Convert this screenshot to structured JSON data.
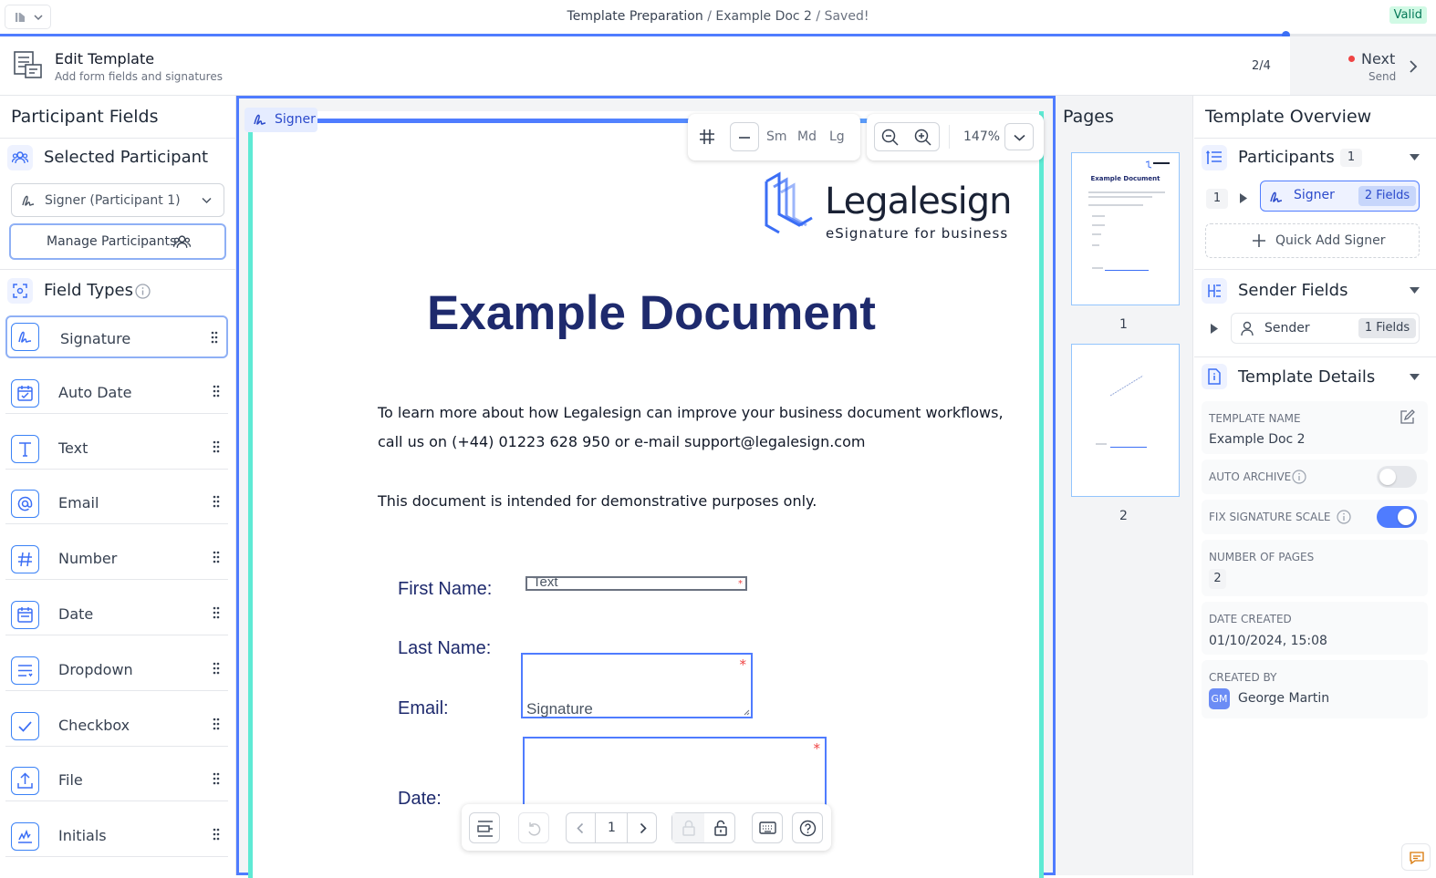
{
  "topbar": {
    "breadcrumb_1": "Template Preparation",
    "sep_1": " / ",
    "breadcrumb_2": "Example Doc 2",
    "sep_2": " / ",
    "status": "Saved!",
    "valid_badge": "Valid",
    "progress_fraction": 0.895
  },
  "header": {
    "title": "Edit Template",
    "subtitle": "Add form fields and signatures",
    "step": "2/4",
    "next_label": "Next",
    "next_sub": "Send"
  },
  "left": {
    "title": "Participant Fields",
    "selected_participant_heading": "Selected Participant",
    "participant_select_value": "Signer (Participant 1)",
    "manage_participants": "Manage Participants",
    "field_types_heading": "Field Types",
    "field_types": [
      {
        "label": "Signature",
        "icon": "signature-icon"
      },
      {
        "label": "Auto Date",
        "icon": "auto-date-icon"
      },
      {
        "label": "Text",
        "icon": "text-icon"
      },
      {
        "label": "Email",
        "icon": "at-icon"
      },
      {
        "label": "Number",
        "icon": "hash-icon"
      },
      {
        "label": "Date",
        "icon": "calendar-icon"
      },
      {
        "label": "Dropdown",
        "icon": "list-icon"
      },
      {
        "label": "Checkbox",
        "icon": "check-icon"
      },
      {
        "label": "File",
        "icon": "upload-icon"
      },
      {
        "label": "Initials",
        "icon": "initials-icon"
      }
    ]
  },
  "doc_toolbar": {
    "size_sm": "Sm",
    "size_md": "Md",
    "size_lg": "Lg",
    "zoom": "147%"
  },
  "document": {
    "signer_chip": "Signer",
    "brand_name": "Legalesign",
    "brand_tagline": "eSignature for business",
    "title": "Example Document",
    "para_1_line_1": "To learn more about how Legalesign can improve your business document workflows,",
    "para_1_line_2": "call us on (+44) 01223 628 950 or e-mail support@legalesign.com",
    "para_2": "This document is intended for demonstrative purposes only.",
    "labels": {
      "first_name": "First Name:",
      "last_name": "Last Name:",
      "email": "Email:",
      "date": "Date:"
    },
    "fields": {
      "text_field_label": "Text",
      "signature_field_label": "Signature",
      "required_mark": "*"
    }
  },
  "bottom_toolbar": {
    "page_input": "1"
  },
  "pages": {
    "title": "Pages",
    "items": [
      {
        "number": "1",
        "thumb_title": "Example Document"
      },
      {
        "number": "2"
      }
    ]
  },
  "right": {
    "title": "Template Overview",
    "participants_heading": "Participants",
    "participants_count": "1",
    "participant_index": "1",
    "participant_role": "Signer",
    "participant_fields": "2 Fields",
    "quick_add": "Quick Add Signer",
    "sender_heading": "Sender Fields",
    "sender_role": "Sender",
    "sender_fields": "1 Fields",
    "details_heading": "Template Details",
    "template_name_label": "TEMPLATE NAME",
    "template_name_value": "Example Doc 2",
    "auto_archive_label": "AUTO ARCHIVE",
    "auto_archive_on": false,
    "fix_sig_label": "FIX SIGNATURE SCALE",
    "fix_sig_on": true,
    "pages_label": "NUMBER OF PAGES",
    "pages_value": "2",
    "created_label": "DATE CREATED",
    "created_value": "01/10/2024, 15:08",
    "created_by_label": "CREATED BY",
    "created_by_initials": "GM",
    "created_by_name": "George Martin"
  },
  "colors": {
    "accent": "#4f7cff",
    "doc_title": "#1e2a6d",
    "valid_bg": "#d1fae5",
    "valid_text": "#047857",
    "teal_border": "#5eead4"
  }
}
